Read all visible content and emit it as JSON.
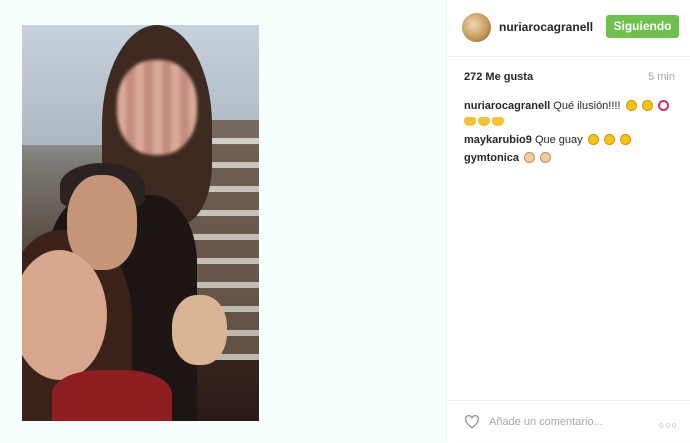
{
  "post": {
    "username": "nuriarocagranell",
    "follow_label": "Siguiendo",
    "likes": "272 Me gusta",
    "time": "5 min",
    "comments": [
      {
        "user": "nuriarocagranell",
        "text": "Qué ilusión!!!!"
      },
      {
        "user": "maykarubio9",
        "text": "Que guay"
      },
      {
        "user": "gymtonica",
        "text": ""
      }
    ],
    "comment_placeholder": "Añade un comentario...",
    "more": "○○○"
  },
  "colors": {
    "follow_button": "#70c050",
    "muted_text": "#a5a7aa"
  },
  "icons": [
    "heart-outline-icon",
    "more-options-icon"
  ]
}
